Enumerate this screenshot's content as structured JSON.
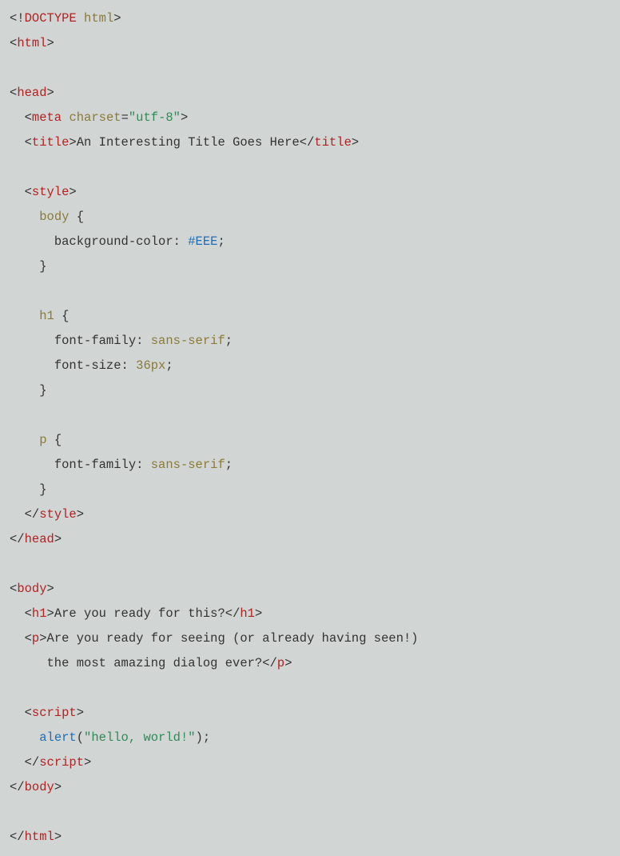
{
  "lines": [
    [
      {
        "c": "t-punct",
        "t": "<!"
      },
      {
        "c": "t-doctype",
        "t": "DOCTYPE"
      },
      {
        "c": "t-punct",
        "t": " "
      },
      {
        "c": "t-doctype-html",
        "t": "html"
      },
      {
        "c": "t-punct",
        "t": ">"
      }
    ],
    [
      {
        "c": "t-punct",
        "t": "<"
      },
      {
        "c": "t-tag",
        "t": "html"
      },
      {
        "c": "t-punct",
        "t": ">"
      }
    ],
    [
      {
        "c": "t-punct",
        "t": ""
      }
    ],
    [
      {
        "c": "t-punct",
        "t": "<"
      },
      {
        "c": "t-tag",
        "t": "head"
      },
      {
        "c": "t-punct",
        "t": ">"
      }
    ],
    [
      {
        "c": "t-punct",
        "t": "  <"
      },
      {
        "c": "t-tag",
        "t": "meta"
      },
      {
        "c": "t-punct",
        "t": " "
      },
      {
        "c": "t-attr",
        "t": "charset"
      },
      {
        "c": "t-punct",
        "t": "="
      },
      {
        "c": "t-string",
        "t": "\"utf-8\""
      },
      {
        "c": "t-punct",
        "t": ">"
      }
    ],
    [
      {
        "c": "t-punct",
        "t": "  <"
      },
      {
        "c": "t-tag",
        "t": "title"
      },
      {
        "c": "t-punct",
        "t": ">"
      },
      {
        "c": "t-text",
        "t": "An Interesting Title Goes Here"
      },
      {
        "c": "t-punct",
        "t": "</"
      },
      {
        "c": "t-tag",
        "t": "title"
      },
      {
        "c": "t-punct",
        "t": ">"
      }
    ],
    [
      {
        "c": "t-punct",
        "t": ""
      }
    ],
    [
      {
        "c": "t-punct",
        "t": "  <"
      },
      {
        "c": "t-tag",
        "t": "style"
      },
      {
        "c": "t-punct",
        "t": ">"
      }
    ],
    [
      {
        "c": "t-punct",
        "t": "    "
      },
      {
        "c": "t-sel",
        "t": "body"
      },
      {
        "c": "t-punct",
        "t": " {"
      }
    ],
    [
      {
        "c": "t-punct",
        "t": "      "
      },
      {
        "c": "t-prop",
        "t": "background-color"
      },
      {
        "c": "t-punct",
        "t": ": "
      },
      {
        "c": "t-hex",
        "t": "#EEE"
      },
      {
        "c": "t-punct",
        "t": ";"
      }
    ],
    [
      {
        "c": "t-punct",
        "t": "    }"
      }
    ],
    [
      {
        "c": "t-punct",
        "t": ""
      }
    ],
    [
      {
        "c": "t-punct",
        "t": "    "
      },
      {
        "c": "t-sel",
        "t": "h1"
      },
      {
        "c": "t-punct",
        "t": " {"
      }
    ],
    [
      {
        "c": "t-punct",
        "t": "      "
      },
      {
        "c": "t-prop",
        "t": "font-family"
      },
      {
        "c": "t-punct",
        "t": ": "
      },
      {
        "c": "t-val",
        "t": "sans-serif"
      },
      {
        "c": "t-punct",
        "t": ";"
      }
    ],
    [
      {
        "c": "t-punct",
        "t": "      "
      },
      {
        "c": "t-prop",
        "t": "font-size"
      },
      {
        "c": "t-punct",
        "t": ": "
      },
      {
        "c": "t-val",
        "t": "36px"
      },
      {
        "c": "t-punct",
        "t": ";"
      }
    ],
    [
      {
        "c": "t-punct",
        "t": "    }"
      }
    ],
    [
      {
        "c": "t-punct",
        "t": ""
      }
    ],
    [
      {
        "c": "t-punct",
        "t": "    "
      },
      {
        "c": "t-sel",
        "t": "p"
      },
      {
        "c": "t-punct",
        "t": " {"
      }
    ],
    [
      {
        "c": "t-punct",
        "t": "      "
      },
      {
        "c": "t-prop",
        "t": "font-family"
      },
      {
        "c": "t-punct",
        "t": ": "
      },
      {
        "c": "t-val",
        "t": "sans-serif"
      },
      {
        "c": "t-punct",
        "t": ";"
      }
    ],
    [
      {
        "c": "t-punct",
        "t": "    }"
      }
    ],
    [
      {
        "c": "t-punct",
        "t": "  </"
      },
      {
        "c": "t-tag",
        "t": "style"
      },
      {
        "c": "t-punct",
        "t": ">"
      }
    ],
    [
      {
        "c": "t-punct",
        "t": "</"
      },
      {
        "c": "t-tag",
        "t": "head"
      },
      {
        "c": "t-punct",
        "t": ">"
      }
    ],
    [
      {
        "c": "t-punct",
        "t": ""
      }
    ],
    [
      {
        "c": "t-punct",
        "t": "<"
      },
      {
        "c": "t-tag",
        "t": "body"
      },
      {
        "c": "t-punct",
        "t": ">"
      }
    ],
    [
      {
        "c": "t-punct",
        "t": "  <"
      },
      {
        "c": "t-tag",
        "t": "h1"
      },
      {
        "c": "t-punct",
        "t": ">"
      },
      {
        "c": "t-text",
        "t": "Are you ready for this?"
      },
      {
        "c": "t-punct",
        "t": "</"
      },
      {
        "c": "t-tag",
        "t": "h1"
      },
      {
        "c": "t-punct",
        "t": ">"
      }
    ],
    [
      {
        "c": "t-punct",
        "t": "  <"
      },
      {
        "c": "t-tag",
        "t": "p"
      },
      {
        "c": "t-punct",
        "t": ">"
      },
      {
        "c": "t-text",
        "t": "Are you ready for seeing (or already having seen!)"
      }
    ],
    [
      {
        "c": "t-text",
        "t": "     the most amazing dialog ever?"
      },
      {
        "c": "t-punct",
        "t": "</"
      },
      {
        "c": "t-tag",
        "t": "p"
      },
      {
        "c": "t-punct",
        "t": ">"
      }
    ],
    [
      {
        "c": "t-punct",
        "t": ""
      }
    ],
    [
      {
        "c": "t-punct",
        "t": "  <"
      },
      {
        "c": "t-tag",
        "t": "script"
      },
      {
        "c": "t-punct",
        "t": ">"
      }
    ],
    [
      {
        "c": "t-punct",
        "t": "    "
      },
      {
        "c": "t-func",
        "t": "alert"
      },
      {
        "c": "t-punct",
        "t": "("
      },
      {
        "c": "t-string",
        "t": "\"hello, world!\""
      },
      {
        "c": "t-punct",
        "t": ");"
      }
    ],
    [
      {
        "c": "t-punct",
        "t": "  </"
      },
      {
        "c": "t-tag",
        "t": "script"
      },
      {
        "c": "t-punct",
        "t": ">"
      }
    ],
    [
      {
        "c": "t-punct",
        "t": "</"
      },
      {
        "c": "t-tag",
        "t": "body"
      },
      {
        "c": "t-punct",
        "t": ">"
      }
    ],
    [
      {
        "c": "t-punct",
        "t": ""
      }
    ],
    [
      {
        "c": "t-punct",
        "t": "</"
      },
      {
        "c": "t-tag",
        "t": "html"
      },
      {
        "c": "t-punct",
        "t": ">"
      }
    ]
  ]
}
